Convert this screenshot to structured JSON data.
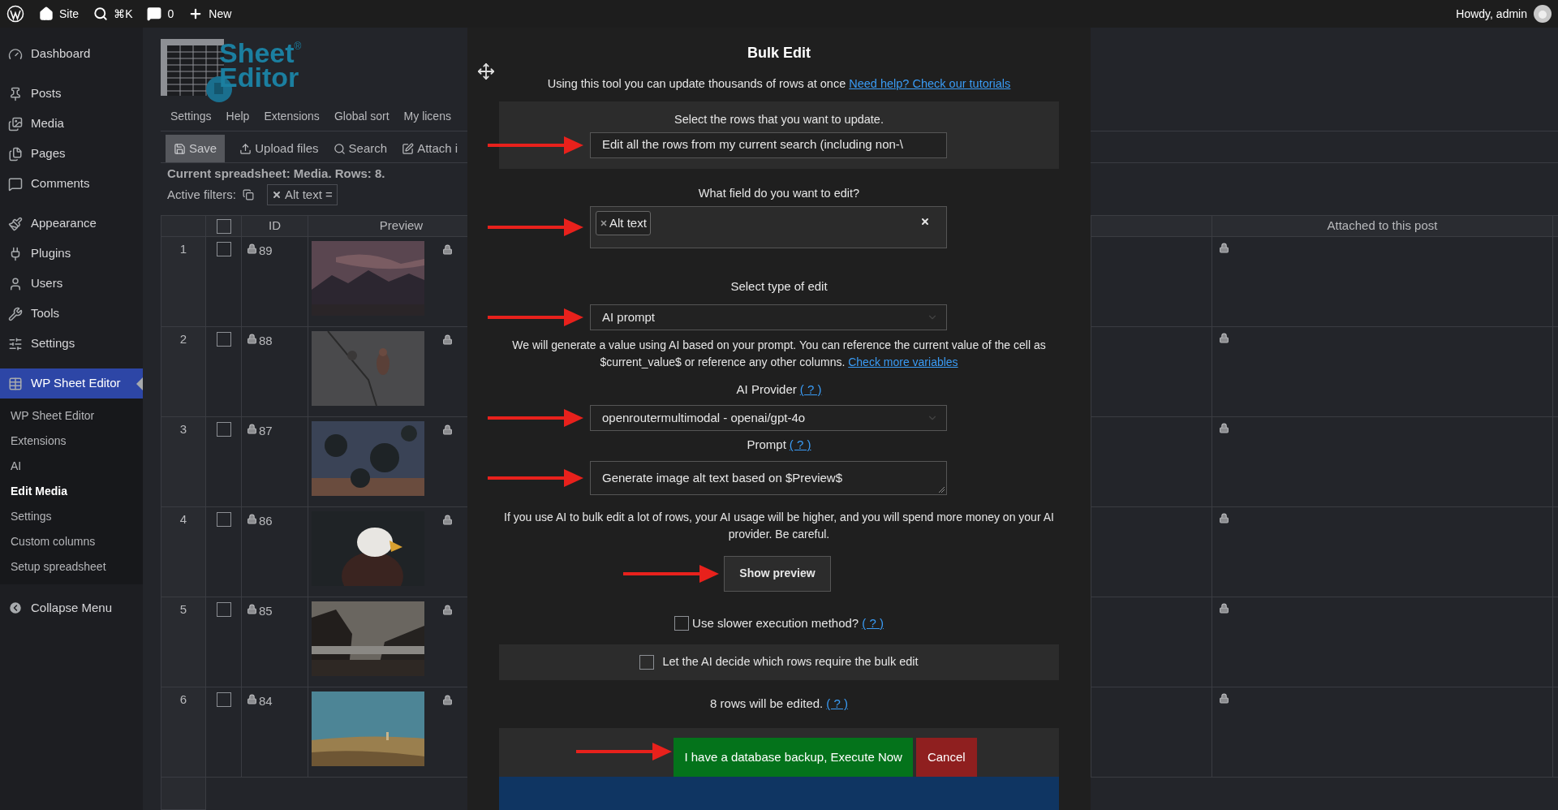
{
  "admin_bar": {
    "items": [
      "Site",
      "⌘K",
      "0",
      "New"
    ],
    "greeting": "Howdy, admin"
  },
  "sidebar": {
    "groups": [
      [
        {
          "label": "Dashboard",
          "selected": false
        }
      ],
      [
        {
          "label": "Posts",
          "selected": false
        },
        {
          "label": "Media",
          "selected": false
        },
        {
          "label": "Pages",
          "selected": false
        },
        {
          "label": "Comments",
          "selected": false
        }
      ],
      [
        {
          "label": "Appearance",
          "selected": false
        },
        {
          "label": "Plugins",
          "selected": false
        },
        {
          "label": "Users",
          "selected": false
        },
        {
          "label": "Tools",
          "selected": false
        },
        {
          "label": "Settings",
          "selected": false
        }
      ],
      [
        {
          "label": "WP Sheet Editor",
          "selected": true,
          "children": [
            {
              "label": "WP Sheet Editor",
              "current": false
            },
            {
              "label": "Extensions",
              "current": false
            },
            {
              "label": "AI",
              "current": false
            },
            {
              "label": "Edit Media",
              "current": true
            },
            {
              "label": "Settings",
              "current": false
            },
            {
              "label": "Custom columns",
              "current": false
            },
            {
              "label": "Setup spreadsheet",
              "current": false
            }
          ]
        }
      ]
    ],
    "collapse": "Collapse Menu"
  },
  "logo": {
    "line1": "Sheet",
    "line2": "Editor",
    "mark": "®"
  },
  "menu": [
    "Settings",
    "Help",
    "Extensions",
    "Global sort",
    "My licens"
  ],
  "toolbar": [
    {
      "label": "Save",
      "primary": true
    },
    {
      "label": "Upload files",
      "primary": false
    },
    {
      "label": "Search",
      "primary": false
    },
    {
      "label": "Attach i",
      "primary": false
    }
  ],
  "spreadsheet_info": "Current spreadsheet: Media. Rows: 8.",
  "filters": {
    "label": "Active filters:",
    "chips": [
      "Alt text ="
    ]
  },
  "table": {
    "header_checked": false,
    "columns": [
      "ID",
      "Preview"
    ],
    "right_columns": [
      "Attached to this post"
    ],
    "rows": [
      {
        "number": "1",
        "id": "89",
        "checked": false
      },
      {
        "number": "2",
        "id": "88",
        "checked": false
      },
      {
        "number": "3",
        "id": "87",
        "checked": false
      },
      {
        "number": "4",
        "id": "86",
        "checked": false
      },
      {
        "number": "5",
        "id": "85",
        "checked": false
      },
      {
        "number": "6",
        "id": "84",
        "checked": false
      }
    ]
  },
  "modal": {
    "title": "Bulk Edit",
    "intro": "Using this tool you can update thousands of rows at once",
    "intro_link": "Need help? Check our tutorials",
    "rows_label": "Select the rows that you want to update.",
    "rows_value": "Edit all the rows from my current search (including non-\\",
    "field_label": "What field do you want to edit?",
    "field_tags": [
      "Alt text"
    ],
    "type_label": "Select type of edit",
    "type_value": "AI prompt",
    "note": "We will generate a value using AI based on your prompt. You can reference the current value of the cell as $current_value$ or reference any other columns.",
    "note_link": "Check more variables",
    "provider_label": "AI Provider",
    "provider_help": "( ? )",
    "provider_value": "openroutermultimodal - openai/gpt-4o",
    "prompt_label": "Prompt",
    "prompt_help": "( ? )",
    "prompt_value": "Generate image alt text based on $Preview$",
    "warning": "If you use AI to bulk edit a lot of rows, your AI usage will be higher, and you will spend more money on your AI provider. Be careful.",
    "preview_button": "Show preview",
    "slower": {
      "label": "Use slower execution method?",
      "help": "( ? )",
      "checked": false
    },
    "ai_decide": {
      "label": "Let the AI decide which rows require the bulk edit",
      "checked": false
    },
    "count": "8 rows will be edited.",
    "count_help": "( ? )",
    "execute_button": "I have a database backup, Execute Now",
    "cancel_button": "Cancel"
  }
}
